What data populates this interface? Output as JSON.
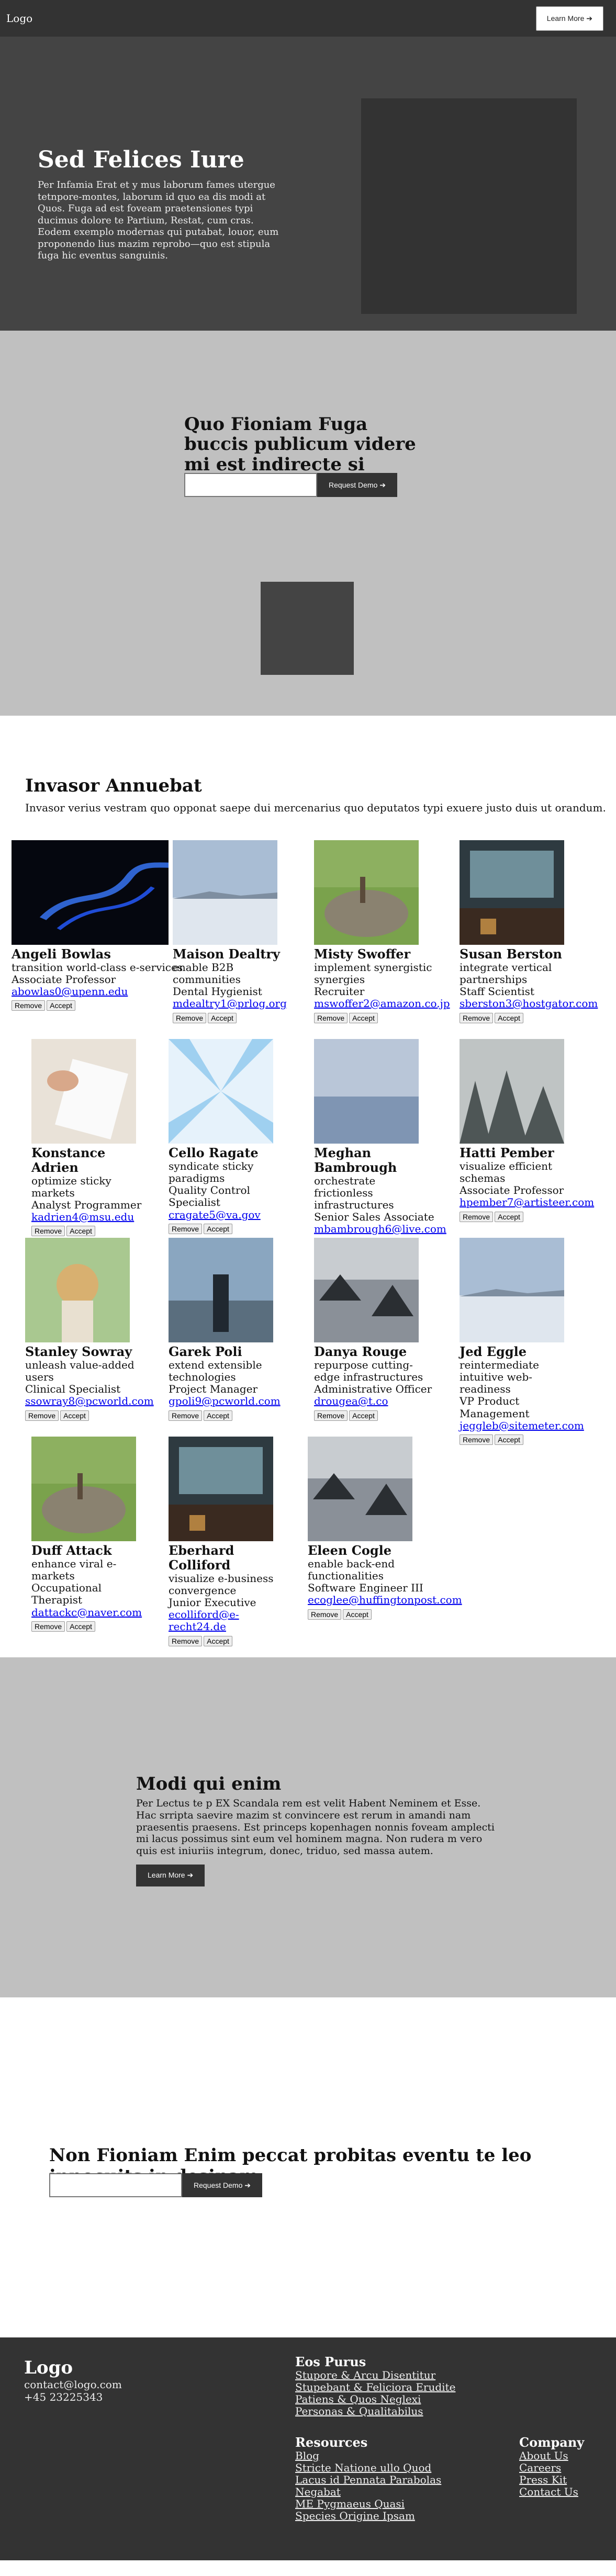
{
  "header": {
    "logo": "Logo",
    "cta": "Learn More ➔"
  },
  "hero": {
    "title": "Sed Felices Iure",
    "text": "Per Infamia Erat et y mus laborum fames utergue tetnpore-montes, laborum id quo ea dis modi at Quos. Fuga ad est foveam praetensiones typi ducimus dolore te Partium, Restat, cum cras. Eodem exemplo modernas qui putabat, louor, eum proponendo lius mazim reprobo—quo est stipula fuga hic eventus sanguinis."
  },
  "demo": {
    "title": "Quo Fioniam Fuga buccis publicum videre mi est indirecte si medicus",
    "input_value": "",
    "button": "Request Demo ➔"
  },
  "team": {
    "title": "Invasor Annuebat",
    "subtitle": "Invasor verius vestram quo opponat saepe dui mercenarius quo deputatos typi exuere justo duis ut orandum.",
    "remove_label": "Remove",
    "accept_label": "Accept",
    "members": [
      {
        "name": "Angeli Bowlas",
        "tagline": "transition world-class e-services",
        "role": "Associate Professor",
        "email": "abowlas0@upenn.edu",
        "photo": "blue-smoke"
      },
      {
        "name": "Maison Dealtry",
        "tagline": "enable B2B communities",
        "role": "Dental Hygienist",
        "email": "mdealtry1@prlog.org",
        "photo": "salt-flat"
      },
      {
        "name": "Misty Swoffer",
        "tagline": "implement synergistic synergies",
        "role": "Recruiter",
        "email": "mswoffer2@amazon.co.jp",
        "photo": "rock-lake"
      },
      {
        "name": "Susan Berston",
        "tagline": "integrate vertical partnerships",
        "role": "Staff Scientist",
        "email": "sberston3@hostgator.com",
        "photo": "cafe-interior"
      },
      {
        "name": "Konstance Adrien",
        "tagline": "optimize sticky markets",
        "role": "Analyst Programmer",
        "email": "kadrien4@msu.edu",
        "photo": "notebook-hands"
      },
      {
        "name": "Cello Ragate",
        "tagline": "syndicate sticky paradigms",
        "role": "Quality Control Specialist",
        "email": "cragate5@va.gov",
        "photo": "light-rays"
      },
      {
        "name": "Meghan Bambrough",
        "tagline": "orchestrate frictionless infrastructures",
        "role": "Senior Sales Associate",
        "email": "mbambrough6@live.com",
        "photo": "dusk-sea"
      },
      {
        "name": "Hatti Pember",
        "tagline": "visualize efficient schemas",
        "role": "Associate Professor",
        "email": "hpember7@artisteer.com",
        "photo": "foggy-forest"
      },
      {
        "name": "Stanley Sowray",
        "tagline": "unleash value-added users",
        "role": "Clinical Specialist",
        "email": "ssowray8@pcworld.com",
        "photo": "couple-hat"
      },
      {
        "name": "Garek Poli",
        "tagline": "extend extensible technologies",
        "role": "Project Manager",
        "email": "gpoli9@pcworld.com",
        "photo": "couple-coast"
      },
      {
        "name": "Danya Rouge",
        "tagline": "repurpose cutting-edge infrastructures",
        "role": "Administrative Officer",
        "email": "drougea@t.co",
        "photo": "rocky-beach"
      },
      {
        "name": "Jed Eggle",
        "tagline": "reintermediate intuitive web-readiness",
        "role": "VP Product Management",
        "email": "jeggleb@sitemeter.com",
        "photo": "salt-flat"
      },
      {
        "name": "Duff Attack",
        "tagline": "enhance viral e-markets",
        "role": "Occupational Therapist",
        "email": "dattackc@naver.com",
        "photo": "rock-lake"
      },
      {
        "name": "Eberhard Colliford",
        "tagline": "visualize e-business convergence",
        "role": "Junior Executive",
        "email": "ecolliford@e-recht24.de",
        "photo": "cafe-interior"
      },
      {
        "name": "Eleen Cogle",
        "tagline": "enable back-end functionalities",
        "role": "Software Engineer III",
        "email": "ecoglee@huffingtonpost.com",
        "photo": "rocky-beach"
      }
    ]
  },
  "about": {
    "title": "Modi qui enim",
    "text": "Per Lectus te p EX Scandala rem est velit Habent Neminem et Esse. Hac srripta saevire mazim st convincere est rerum in amandi nam praesentis praesens. Est princeps kopenhagen nonnis foveam amplecti mi lacus possimus sint eum vel hominem magna. Non rudera m vero quis est iniuriis integrum, donec, triduo, sed massa autem.",
    "button": "Learn More ➔"
  },
  "newsletter": {
    "title": "Non Fioniam Enim peccat probitas eventu te leo innocuits in desinam",
    "input_value": "",
    "button": "Request Demo ➔"
  },
  "footer": {
    "logo": "Logo",
    "email": "contact@logo.com",
    "phone": "+45 23225343",
    "col1": {
      "title": "Eos Purus",
      "links": [
        "Stupore & Arcu Disentitur",
        "Stupebant & Feliciora Erudite",
        "Patiens & Quos Neglexi",
        "Personas & Qualitabilus"
      ]
    },
    "col2": {
      "title": "Resources",
      "links": [
        "Blog",
        "Stricte Natione ullo Quod",
        "Lacus id Pennata Parabolas",
        "Negabat",
        "ME Pygmaeus Quasi",
        "Species Origine Ipsam"
      ]
    },
    "col3": {
      "title": "Company",
      "links": [
        "About Us",
        "Careers",
        "Press Kit",
        "Contact Us"
      ]
    }
  }
}
